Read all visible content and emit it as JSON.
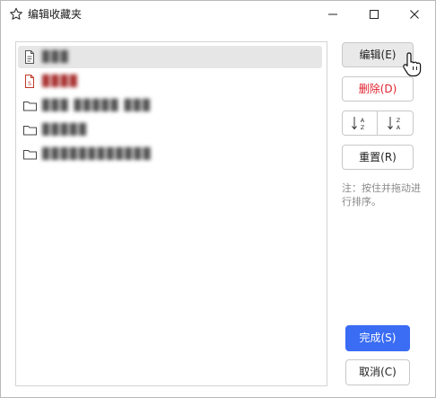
{
  "window": {
    "title": "编辑收藏夹",
    "icon": "star-outline-icon"
  },
  "list": {
    "items": [
      {
        "label": "▉▉▉",
        "icon": "document-icon",
        "selected": true,
        "color": "#555555"
      },
      {
        "label": "▉▉▉▉",
        "icon": "pdf-document-icon",
        "selected": false,
        "color": "#aa3333"
      },
      {
        "label": "▉▉▉ ▉▉▉▉▉ ▉▉▉",
        "icon": "folder-icon",
        "selected": false,
        "color": "#555555"
      },
      {
        "label": "▉▉▉▉▉",
        "icon": "folder-icon",
        "selected": false,
        "color": "#555555"
      },
      {
        "label": "▉▉▉▉▉▉▉▉▉▉▉▉",
        "icon": "folder-icon",
        "selected": false,
        "color": "#555555"
      }
    ]
  },
  "actions": {
    "edit_label": "编辑(E)",
    "delete_label": "删除(D)",
    "sort_asc_icon": "sort-a-to-z-icon",
    "sort_desc_icon": "sort-z-to-a-icon",
    "reset_label": "重置(R)",
    "note": "注：按住并拖动进行排序。",
    "done_label": "完成(S)",
    "cancel_label": "取消(C)"
  },
  "colors": {
    "primary": "#3a6cf4",
    "danger": "#e0232d",
    "selected_row": "#e6e6e6"
  }
}
